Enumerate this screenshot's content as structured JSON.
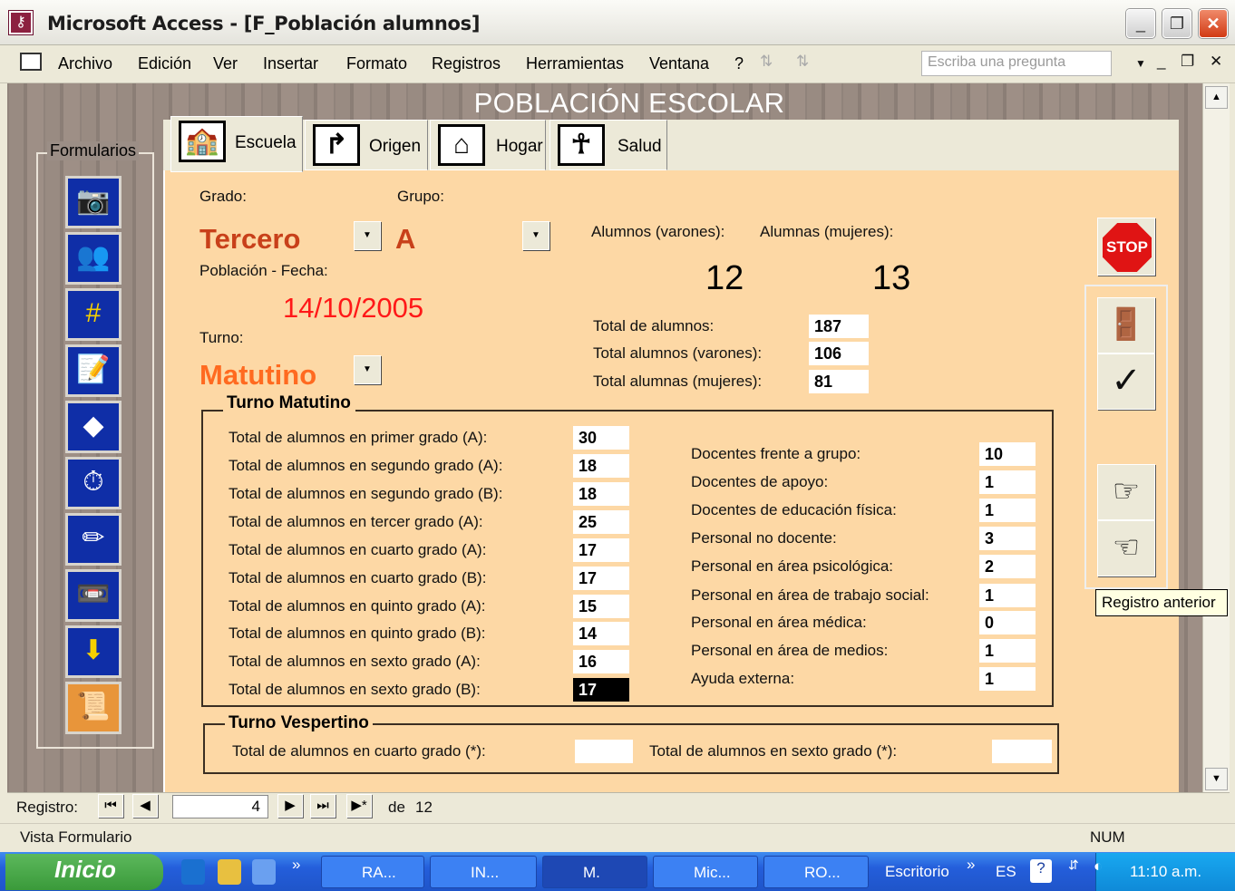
{
  "titlebar": {
    "title": "Microsoft Access - [F_Población alumnos]"
  },
  "menu": {
    "items": [
      "Archivo",
      "Edición",
      "Ver",
      "Insertar",
      "Formato",
      "Registros",
      "Herramientas",
      "Ventana",
      "?"
    ],
    "ask_placeholder": "Escriba una pregunta"
  },
  "form": {
    "title": "POBLACIÓN ESCOLAR",
    "sidebar_label": "Formularios",
    "tabs": [
      "Escuela",
      "Origen",
      "Hogar",
      "Salud"
    ],
    "grado_label": "Grado:",
    "grupo_label": "Grupo:",
    "grado_value": "Tercero",
    "grupo_value": "A",
    "fecha_label": "Población - Fecha:",
    "fecha_value": "14/10/2005",
    "turno_label": "Turno:",
    "turno_value": "Matutino",
    "varones_label": "Alumnos (varones):",
    "mujeres_label": "Alumnas (mujeres):",
    "varones_value": "12",
    "mujeres_value": "13",
    "totals": [
      {
        "label": "Total de alumnos:",
        "value": "187"
      },
      {
        "label": "Total alumnos (varones):",
        "value": "106"
      },
      {
        "label": "Total alumnas (mujeres):",
        "value": "81"
      }
    ],
    "matutino_title": "Turno Matutino",
    "matutino_rows": [
      {
        "label": "Total de alumnos en primer grado (A):",
        "value": "30"
      },
      {
        "label": "Total de alumnos en segundo grado (A):",
        "value": "18"
      },
      {
        "label": "Total de alumnos en segundo grado (B):",
        "value": "18"
      },
      {
        "label": "Total de alumnos en tercer grado (A):",
        "value": "25"
      },
      {
        "label": "Total de alumnos en cuarto grado (A):",
        "value": "17"
      },
      {
        "label": "Total de alumnos en cuarto grado (B):",
        "value": "17"
      },
      {
        "label": "Total de alumnos en quinto grado (A):",
        "value": "15"
      },
      {
        "label": "Total de alumnos en quinto grado (B):",
        "value": "14"
      },
      {
        "label": "Total de alumnos en sexto grado (A):",
        "value": "16"
      },
      {
        "label": "Total de alumnos en sexto grado (B):",
        "value": "17"
      }
    ],
    "staff_rows": [
      {
        "label": "Docentes frente a grupo:",
        "value": "10"
      },
      {
        "label": "Docentes de apoyo:",
        "value": "1"
      },
      {
        "label": "Docentes de educación física:",
        "value": "1"
      },
      {
        "label": "Personal no docente:",
        "value": "3"
      },
      {
        "label": "Personal en área psicológica:",
        "value": "2"
      },
      {
        "label": "Personal en área de trabajo social:",
        "value": "1"
      },
      {
        "label": "Personal en área médica:",
        "value": "0"
      },
      {
        "label": "Personal en área de medios:",
        "value": "1"
      },
      {
        "label": "Ayuda externa:",
        "value": "1"
      }
    ],
    "vespertino_title": "Turno Vespertino",
    "vesp_cuarto_label": "Total de alumnos en cuarto grado (*):",
    "vesp_sexto_label": "Total de alumnos en sexto grado (*):",
    "stop_label": "STOP",
    "tooltip": "Registro anterior"
  },
  "recnav": {
    "label": "Registro:",
    "current": "4",
    "of_label": "de",
    "total": "12"
  },
  "status": {
    "left": "Vista Formulario",
    "right": "NUM"
  },
  "taskbar": {
    "start": "Inicio",
    "items": [
      "RA...",
      "IN...",
      "M.",
      "Mic...",
      "RO..."
    ],
    "desktop": "Escritorio",
    "lang": "ES",
    "time": "11:10 a.m."
  }
}
